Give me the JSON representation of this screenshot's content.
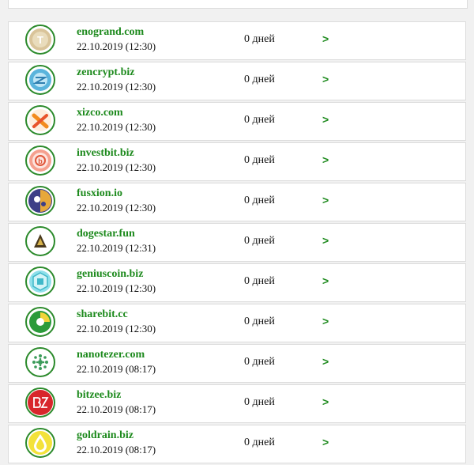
{
  "colors": {
    "accent": "#1d8a1d",
    "border": "#dcdcdc",
    "background": "#f1f1f1"
  },
  "projects": [
    {
      "name": "enogrand.com",
      "date": "22.10.2019 (12:30)",
      "days": "0 дней",
      "arrow": ">",
      "icon": "enogrand-logo-icon"
    },
    {
      "name": "zencrypt.biz",
      "date": "22.10.2019 (12:30)",
      "days": "0 дней",
      "arrow": ">",
      "icon": "zencrypt-logo-icon"
    },
    {
      "name": "xizco.com",
      "date": "22.10.2019 (12:30)",
      "days": "0 дней",
      "arrow": ">",
      "icon": "xizco-logo-icon"
    },
    {
      "name": "investbit.biz",
      "date": "22.10.2019 (12:30)",
      "days": "0 дней",
      "arrow": ">",
      "icon": "investbit-logo-icon"
    },
    {
      "name": "fusxion.io",
      "date": "22.10.2019 (12:30)",
      "days": "0 дней",
      "arrow": ">",
      "icon": "fusxion-logo-icon"
    },
    {
      "name": "dogestar.fun",
      "date": "22.10.2019 (12:31)",
      "days": "0 дней",
      "arrow": ">",
      "icon": "dogestar-logo-icon"
    },
    {
      "name": "geniuscoin.biz",
      "date": "22.10.2019 (12:30)",
      "days": "0 дней",
      "arrow": ">",
      "icon": "geniuscoin-logo-icon"
    },
    {
      "name": "sharebit.cc",
      "date": "22.10.2019 (12:30)",
      "days": "0 дней",
      "arrow": ">",
      "icon": "sharebit-logo-icon"
    },
    {
      "name": "nanotezer.com",
      "date": "22.10.2019 (08:17)",
      "days": "0 дней",
      "arrow": ">",
      "icon": "nanotezer-logo-icon"
    },
    {
      "name": "bitzee.biz",
      "date": "22.10.2019 (08:17)",
      "days": "0 дней",
      "arrow": ">",
      "icon": "bitzee-logo-icon"
    },
    {
      "name": "goldrain.biz",
      "date": "22.10.2019 (08:17)",
      "days": "0 дней",
      "arrow": ">",
      "icon": "goldrain-logo-icon"
    }
  ]
}
